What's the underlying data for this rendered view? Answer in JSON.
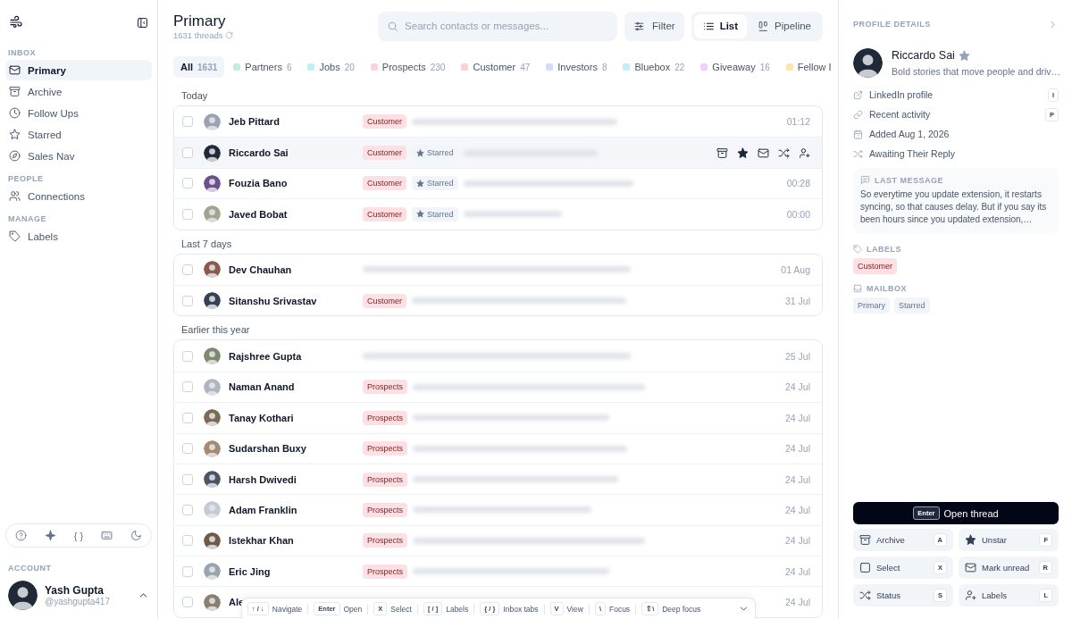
{
  "sidebar": {
    "sections": [
      {
        "heading": "INBOX",
        "items": [
          {
            "label": "Primary",
            "selected": true
          },
          {
            "label": "Archive",
            "selected": false
          },
          {
            "label": "Follow Ups",
            "selected": false
          },
          {
            "label": "Starred",
            "selected": false
          },
          {
            "label": "Sales Nav",
            "selected": false
          }
        ]
      },
      {
        "heading": "PEOPLE",
        "items": [
          {
            "label": "Connections",
            "selected": false
          }
        ]
      },
      {
        "heading": "MANAGE",
        "items": [
          {
            "label": "Labels",
            "selected": false
          }
        ]
      }
    ],
    "tools": [
      {
        "kind": "icon"
      },
      {
        "kind": "icon"
      },
      {
        "kind": "text",
        "text": "{ }"
      },
      {
        "kind": "icon"
      },
      {
        "kind": "icon"
      }
    ],
    "account": {
      "heading": "ACCOUNT",
      "name": "Yash Gupta",
      "handle": "@yashgupta417"
    }
  },
  "header": {
    "title": "Primary",
    "subtitle": "1631 threads",
    "search": {
      "placeholder": "Search contacts or messages..."
    },
    "filter": "Filter",
    "views": [
      {
        "label": "List",
        "selected": true
      },
      {
        "label": "Pipeline",
        "selected": false
      }
    ]
  },
  "tabs": [
    {
      "label": "All",
      "count": "1631",
      "selected": true
    },
    {
      "label": "Partners",
      "count": "6",
      "selected": false,
      "color": "#bff0da"
    },
    {
      "label": "Jobs",
      "count": "20",
      "selected": false,
      "color": "#c2eef8"
    },
    {
      "label": "Prospects",
      "count": "230",
      "selected": false,
      "color": "#fbd3d6"
    },
    {
      "label": "Customer",
      "count": "47",
      "selected": false,
      "color": "#fbd3d6"
    },
    {
      "label": "Investors",
      "count": "8",
      "selected": false,
      "color": "#d2ddfb"
    },
    {
      "label": "Bluebox",
      "count": "22",
      "selected": false,
      "color": "#c2eef8"
    },
    {
      "label": "Giveaway",
      "count": "16",
      "selected": false,
      "color": "#f1d0fb"
    },
    {
      "label": "Fellow I",
      "selected": false,
      "color": "#fbe8a8"
    }
  ],
  "groups": [
    {
      "heading": "Today",
      "threads": [
        {
          "name": "Jeb Pittard",
          "checked": false,
          "selected": false,
          "labels": [
            {
              "text": "Customer",
              "kind": "label"
            }
          ],
          "time": "01:12"
        },
        {
          "name": "Riccardo Sai",
          "checked": false,
          "selected": true,
          "labels": [
            {
              "text": "Customer",
              "kind": "label"
            },
            {
              "text": "Starred",
              "kind": "starred"
            }
          ]
        },
        {
          "name": "Fouzia Bano",
          "checked": false,
          "selected": false,
          "labels": [
            {
              "text": "Customer",
              "kind": "label"
            },
            {
              "text": "Starred",
              "kind": "starred"
            }
          ],
          "time": "00:28"
        },
        {
          "name": "Javed Bobat",
          "checked": false,
          "selected": false,
          "labels": [
            {
              "text": "Customer",
              "kind": "label"
            },
            {
              "text": "Starred",
              "kind": "starred"
            }
          ],
          "time": "00:00"
        }
      ]
    },
    {
      "heading": "Last 7 days",
      "threads": [
        {
          "name": "Dev Chauhan",
          "checked": false,
          "selected": false,
          "time": "01 Aug"
        },
        {
          "name": "Sitanshu Srivastav",
          "checked": false,
          "selected": false,
          "labels": [
            {
              "text": "Customer",
              "kind": "label"
            }
          ],
          "time": "31 Jul"
        }
      ]
    },
    {
      "heading": "Earlier this year",
      "threads": [
        {
          "name": "Rajshree Gupta",
          "checked": false,
          "selected": false,
          "time": "25 Jul"
        },
        {
          "name": "Naman Anand",
          "checked": false,
          "selected": false,
          "labels": [
            {
              "text": "Prospects",
              "kind": "label"
            }
          ],
          "time": "24 Jul"
        },
        {
          "name": "Tanay Kothari",
          "checked": false,
          "selected": false,
          "labels": [
            {
              "text": "Prospects",
              "kind": "label"
            }
          ],
          "time": "24 Jul"
        },
        {
          "name": "Sudarshan Buxy",
          "checked": false,
          "selected": false,
          "labels": [
            {
              "text": "Prospects",
              "kind": "label"
            }
          ],
          "time": "24 Jul"
        },
        {
          "name": "Harsh Dwivedi",
          "checked": false,
          "selected": false,
          "labels": [
            {
              "text": "Prospects",
              "kind": "label"
            }
          ],
          "time": "24 Jul"
        },
        {
          "name": "Adam Franklin",
          "checked": false,
          "selected": false,
          "labels": [
            {
              "text": "Prospects",
              "kind": "label"
            }
          ],
          "time": "24 Jul"
        },
        {
          "name": "Istekhar Khan",
          "checked": false,
          "selected": false,
          "labels": [
            {
              "text": "Prospects",
              "kind": "label"
            }
          ],
          "time": "24 Jul"
        },
        {
          "name": "Eric Jing",
          "checked": false,
          "selected": false,
          "labels": [
            {
              "text": "Prospects",
              "kind": "label"
            }
          ],
          "time": "24 Jul"
        },
        {
          "name": "Ale",
          "checked": false,
          "time": "24 Jul"
        }
      ]
    }
  ],
  "shortcuts": [
    {
      "keys": "↑ / ↓",
      "label": "Navigate"
    },
    {
      "keys": "Enter",
      "label": "Open"
    },
    {
      "keys": "X",
      "label": "Select"
    },
    {
      "keys": "[ / ]",
      "label": "Labels"
    },
    {
      "keys": "{ / }",
      "label": "Inbox tabs"
    },
    {
      "keys": "V",
      "label": "View"
    },
    {
      "keys": "\\",
      "label": "Focus"
    },
    {
      "keys": "⇧\\",
      "label": "Deep focus"
    }
  ],
  "profile": {
    "heading": "PROFILE DETAILS",
    "name": "Riccardo Sai",
    "starred": true,
    "bio": "Bold stories that move people and driv…",
    "links": [
      {
        "text": "LinkedIn profile",
        "key": "I"
      },
      {
        "text": "Recent activity",
        "key": "P"
      },
      {
        "text": "Added Aug 1, 2026"
      },
      {
        "text": "Awaiting Their Reply"
      }
    ],
    "last_message": {
      "heading": "LAST MESSAGE",
      "text": "So everytime you update extension, it restarts syncing, so that causes delay. But if you say its been hours since you updated extension,…"
    },
    "labels": {
      "heading": "LABELS",
      "items": [
        "Customer"
      ]
    },
    "mailbox": {
      "heading": "MAILBOX",
      "items": [
        "Primary",
        "Starred"
      ]
    },
    "open_button": {
      "key": "Enter",
      "label": "Open thread"
    },
    "actions": [
      {
        "label": "Archive",
        "key": "A"
      },
      {
        "label": "Unstar",
        "key": "F"
      },
      {
        "label": "Select",
        "key": "X"
      },
      {
        "label": "Mark unread",
        "key": "R"
      },
      {
        "label": "Status",
        "key": "S"
      },
      {
        "label": "Labels",
        "key": "L"
      }
    ]
  }
}
